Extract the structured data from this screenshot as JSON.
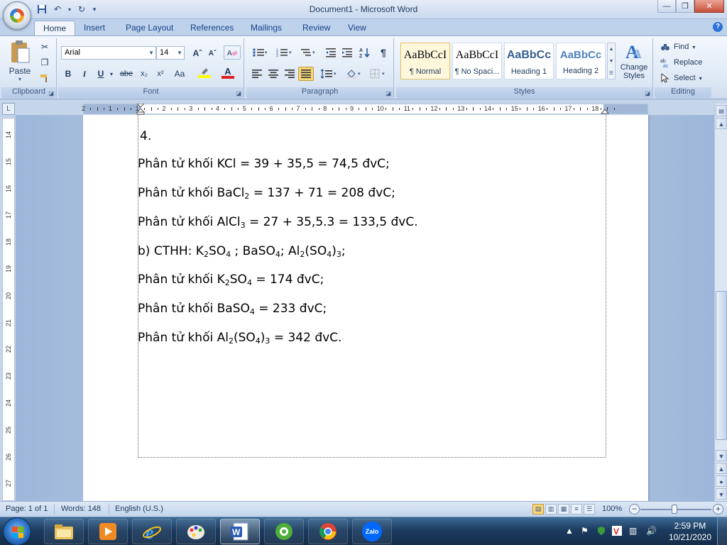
{
  "window": {
    "title": "Document1 - Microsoft Word",
    "controls": [
      "—",
      "❐",
      "✕"
    ]
  },
  "qat": {
    "save": "💾",
    "undo": "↶",
    "redo": "↻",
    "customize": "▾"
  },
  "tabs": [
    "Home",
    "Insert",
    "Page Layout",
    "References",
    "Mailings",
    "Review",
    "View"
  ],
  "ribbon": {
    "clipboard": {
      "label": "Clipboard",
      "paste": "Paste"
    },
    "font": {
      "label": "Font",
      "name": "Arial",
      "size": "14",
      "grow": "Aˆ",
      "shrink": "Aˇ",
      "bold": "B",
      "italic": "I",
      "underline": "U",
      "strike": "abe",
      "subscript": "x₂",
      "superscript": "x²",
      "case": "Aa"
    },
    "paragraph": {
      "label": "Paragraph",
      "pilcrow": "¶"
    },
    "styles": {
      "label": "Styles",
      "items": [
        {
          "preview": "AaBbCcI",
          "name": "¶ Normal"
        },
        {
          "preview": "AaBbCcI",
          "name": "¶ No Spaci..."
        },
        {
          "preview": "AaBbCc",
          "name": "Heading 1"
        },
        {
          "preview": "AaBbCc",
          "name": "Heading 2"
        }
      ],
      "change_styles": "Change Styles"
    },
    "editing": {
      "label": "Editing",
      "find": "Find",
      "replace": "Replace",
      "select": "Select"
    }
  },
  "ruler": {
    "corner": "L",
    "h_numbers": [
      "2",
      "1",
      "1",
      "2",
      "3",
      "4",
      "5",
      "6",
      "7",
      "8",
      "9",
      "10",
      "11",
      "12",
      "13",
      "14",
      "15",
      "16",
      "17",
      "18"
    ],
    "v_numbers": [
      "14",
      "15",
      "16",
      "17",
      "18",
      "19",
      "20",
      "21",
      "22",
      "23",
      "24",
      "25",
      "26",
      "27"
    ]
  },
  "document": {
    "line0": "4.",
    "line1": "Phân tử khối KCl = 39 + 35,5 = 74,5 đvC;",
    "line2": {
      "a": "Phân tử khối BaCl",
      "s1": "2",
      "b": " = 137 + 71 = 208 đvC;"
    },
    "line3": {
      "a": "Phân tử khối AlCl",
      "s1": "3",
      "b": " = 27 + 35,5.3 = 133,5 đvC."
    },
    "line4": {
      "a": "b) CTHH: K",
      "s1": "2",
      "b": "SO",
      "s2": "4",
      "c": " ; BaSO",
      "s3": "4",
      "d": "; Al",
      "s4": "2",
      "e": "(SO",
      "s5": "4",
      "f": ")",
      "s6": "3",
      "g": ";"
    },
    "line5": {
      "a": "Phân tử khối K",
      "s1": "2",
      "b": "SO",
      "s2": "4",
      "c": " = 174 đvC;"
    },
    "line6": {
      "a": "Phân tử khối BaSO",
      "s1": "4",
      "b": " = 233 đvC;"
    },
    "line7": {
      "a": "Phân tử khối Al",
      "s1": "2",
      "b": "(SO",
      "s2": "4",
      "c": ")",
      "s3": "3",
      "d": " = 342 đvC."
    }
  },
  "statusbar": {
    "page": "Page: 1 of 1",
    "words": "Words: 148",
    "language": "English (U.S.)",
    "zoom": "100%"
  },
  "taskbar": {
    "time": "2:59 PM",
    "date": "10/21/2020",
    "apps": [
      "explorer",
      "media-player",
      "internet-explorer",
      "paint",
      "word",
      "coccoc",
      "chrome",
      "zalo"
    ],
    "zalo_label": "Zalo"
  },
  "colors": {
    "ribbon_bg": "#dce7f5",
    "accent": "#15428b",
    "heading1": "#365f91",
    "heading2": "#4f81bd",
    "font_color_bar": "#e02020",
    "highlight_bar": "#ffff00"
  }
}
